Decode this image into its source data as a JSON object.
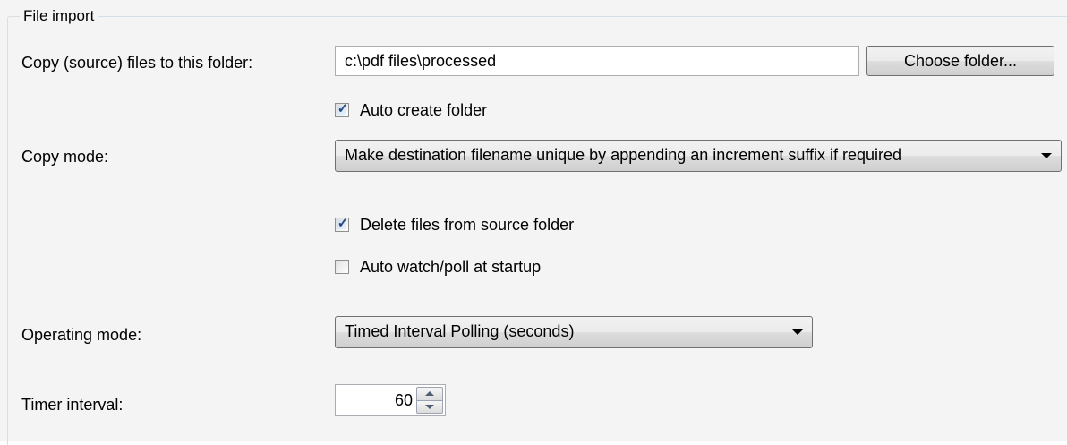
{
  "group": {
    "title": "File import"
  },
  "copy_folder": {
    "label": "Copy (source) files to this folder:",
    "value": "c:\\pdf files\\processed",
    "button_label": "Choose folder..."
  },
  "auto_create": {
    "label": "Auto create folder",
    "checked": true
  },
  "copy_mode": {
    "label": "Copy mode:",
    "selected": "Make destination filename unique by appending an increment suffix if required"
  },
  "delete_files": {
    "label": "Delete files from source folder",
    "checked": true
  },
  "auto_watch": {
    "label": "Auto watch/poll at startup",
    "checked": false
  },
  "operating_mode": {
    "label": "Operating mode:",
    "selected": "Timed Interval Polling (seconds)"
  },
  "timer": {
    "label": "Timer interval:",
    "value": "60"
  },
  "icons": {
    "checkbox_tick": "checkmark-icon",
    "dropdown": "chevron-down-icon",
    "spin_up": "arrow-up-icon",
    "spin_down": "arrow-down-icon"
  }
}
